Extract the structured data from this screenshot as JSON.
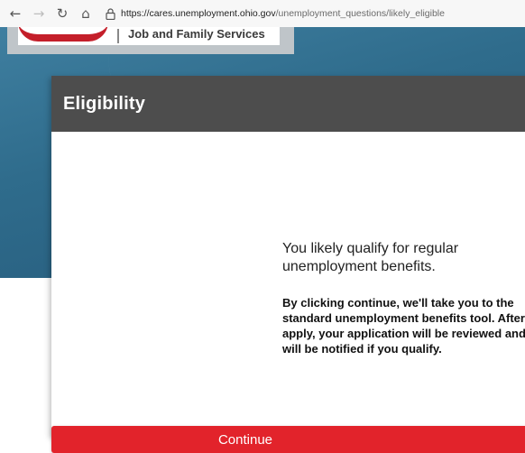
{
  "browser": {
    "back_icon": "←",
    "forward_icon": "→",
    "reload_icon": "↻",
    "home_icon": "⌂",
    "url_host": "https://cares.unemployment.ohio.gov",
    "url_path": "/unemployment_questions/likely_eligible"
  },
  "header": {
    "logo_text": "Job and Family Services"
  },
  "modal": {
    "title": "Eligibility",
    "lead": "You likely qualify for regular unemployment benefits.",
    "detail": "By clicking continue, we'll take you to the standard unemployment benefits tool. After you apply, your application will be reviewed and you will be notified if you qualify.",
    "continue_label": "Continue"
  },
  "colors": {
    "header_bg": "#4d4d4d",
    "button_red": "#e2232b",
    "hero_blue": "#2f6c8c"
  }
}
